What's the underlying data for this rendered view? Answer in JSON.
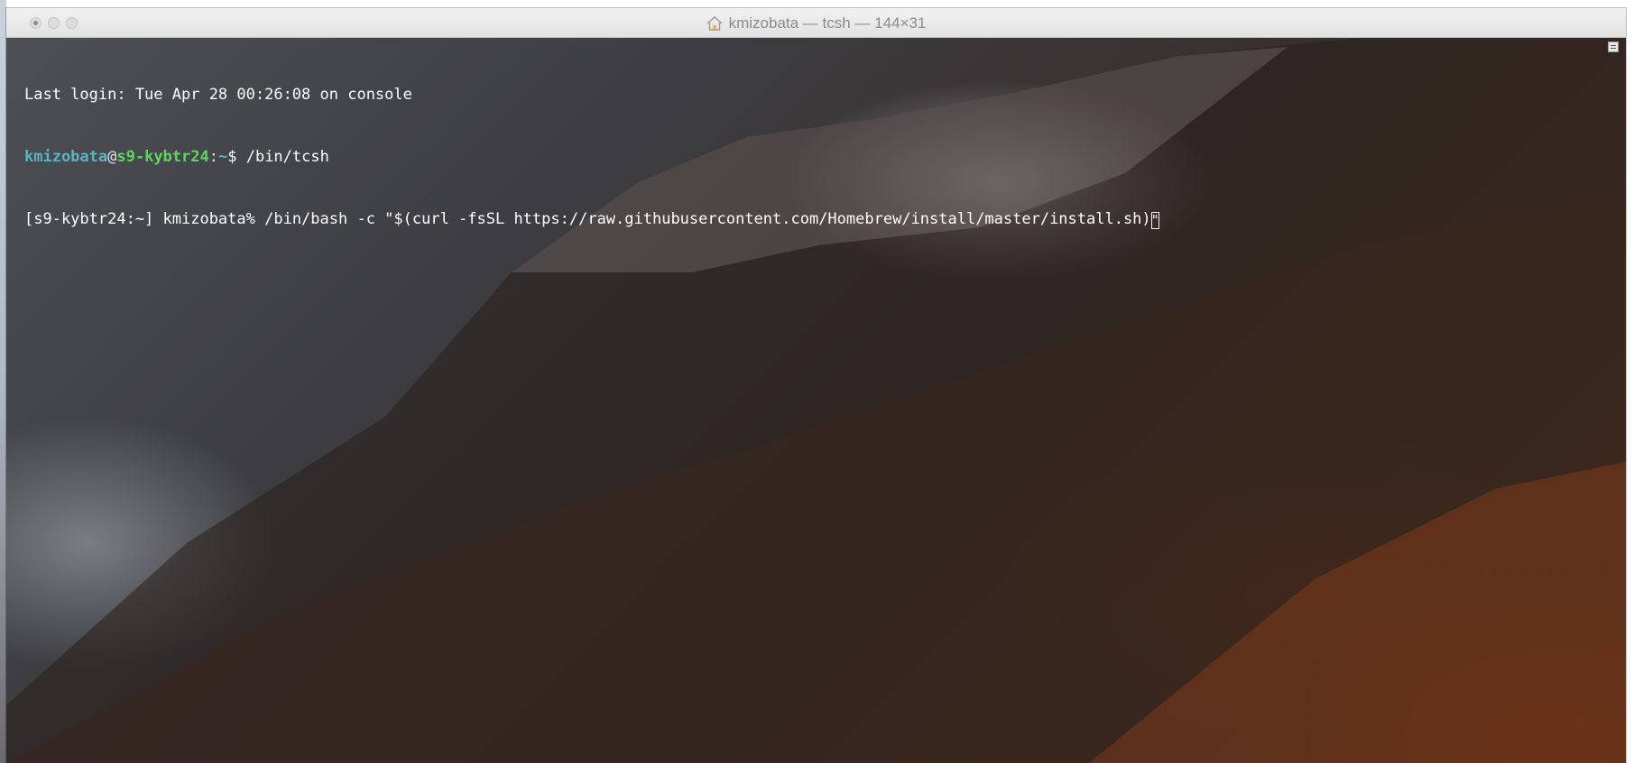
{
  "window": {
    "title": "kmizobata — tcsh — 144×31",
    "title_icon": "home-icon"
  },
  "terminal": {
    "line1": "Last login: Tue Apr 28 00:26:08 on console",
    "line2": {
      "user": "kmizobata",
      "at": "@",
      "host": "s9-kybtr24",
      "sep": ":",
      "path": "~",
      "prompt": "$ ",
      "command": "/bin/tcsh"
    },
    "line3": {
      "prompt": "[s9-kybtr24:~] kmizobata% ",
      "command": "/bin/bash -c \"$(curl -fsSL https://raw.githubusercontent.com/Homebrew/install/master/install.sh)",
      "cursor_char": "\""
    }
  },
  "colors": {
    "user": "#56b6c2",
    "host": "#5ed65e",
    "text": "#ffffff"
  }
}
